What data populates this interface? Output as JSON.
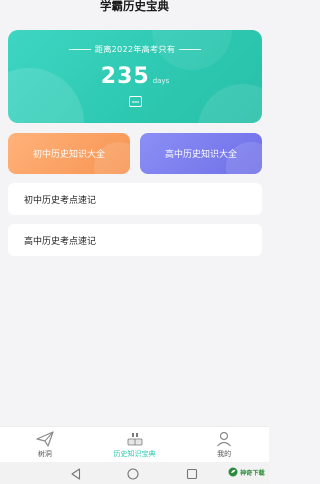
{
  "app": {
    "title": "学霸历史宝典"
  },
  "countdown": {
    "text": "距离2022年高考只有",
    "days": "235",
    "unit": "days"
  },
  "categories": [
    {
      "label": "初中历史知识大全"
    },
    {
      "label": "高中历史知识大全"
    }
  ],
  "list": [
    {
      "label": "初中历史考点速记"
    },
    {
      "label": "高中历史考点速记"
    }
  ],
  "tabs": [
    {
      "label": "树洞",
      "icon": "paper-plane-icon"
    },
    {
      "label": "历史知识宝典",
      "icon": "book-icon",
      "active": true
    },
    {
      "label": "我的",
      "icon": "user-icon"
    }
  ],
  "watermark": {
    "text": "神奇下载"
  },
  "colors": {
    "accent": "#2ec9b2",
    "junior": "#f79452",
    "senior": "#6f6fe8"
  }
}
